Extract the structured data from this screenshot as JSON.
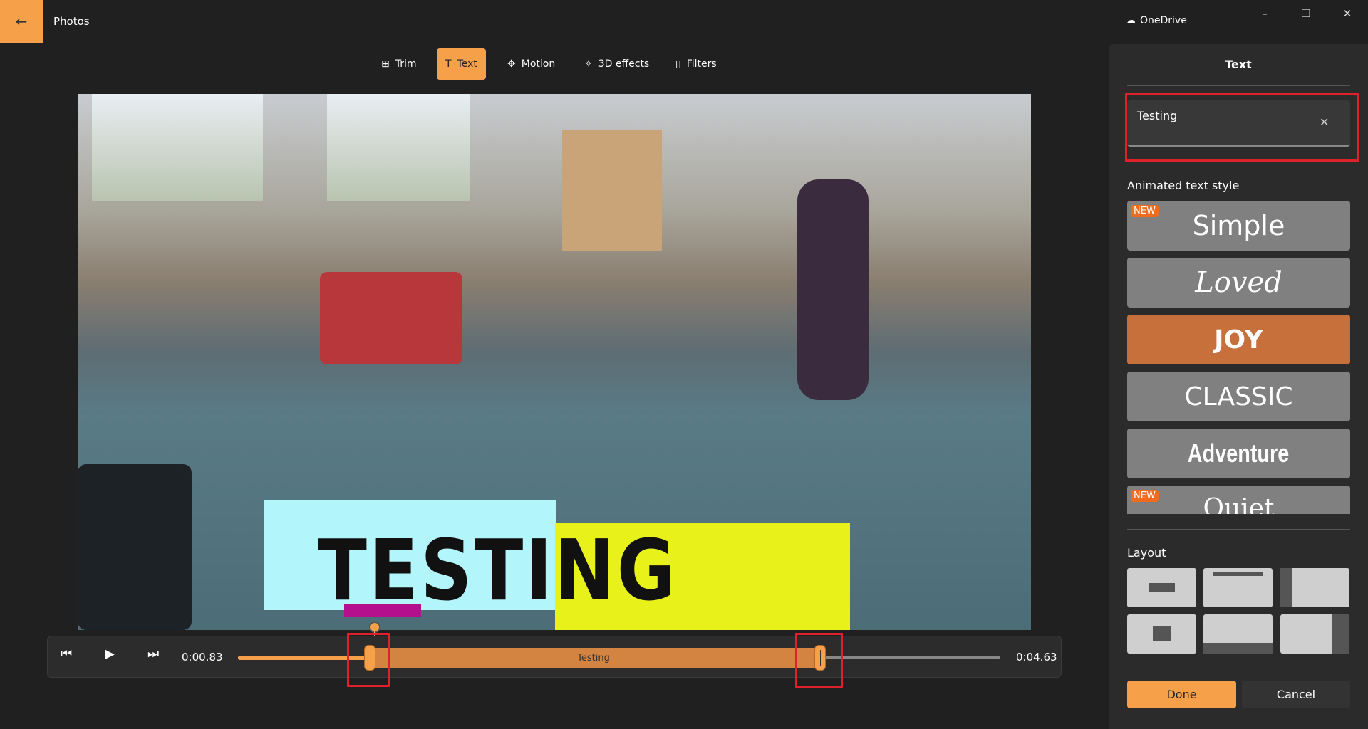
{
  "app": {
    "title": "Photos",
    "account": "OneDrive",
    "back_icon": "arrow-left-icon"
  },
  "window": {
    "minimize": "–",
    "restore": "❐",
    "close": "✕"
  },
  "toolbar": {
    "items": [
      {
        "label": "Trim",
        "icon": "trim-icon",
        "active": false
      },
      {
        "label": "Text",
        "icon": "text-add-icon",
        "active": true
      },
      {
        "label": "Motion",
        "icon": "motion-icon",
        "active": false
      },
      {
        "label": "3D effects",
        "icon": "3d-effects-icon",
        "active": false
      },
      {
        "label": "Filters",
        "icon": "filters-icon",
        "active": false
      }
    ]
  },
  "preview": {
    "overlay_text": "TESTING"
  },
  "timeline": {
    "current_time": "0:00.83",
    "end_time": "0:04.63",
    "clip_label": "Testing"
  },
  "panel": {
    "title": "Text",
    "text_value": "Testing",
    "style_label": "Animated text style",
    "styles": [
      {
        "label": "Simple",
        "badge": "NEW"
      },
      {
        "label": "Loved"
      },
      {
        "label": "JOY",
        "selected": true
      },
      {
        "label": "CLASSIC"
      },
      {
        "label": "Adventure"
      },
      {
        "label": "Quiet",
        "badge": "NEW"
      }
    ],
    "layout_label": "Layout",
    "done": "Done",
    "cancel": "Cancel"
  },
  "colors": {
    "accent": "#f7a04a",
    "selected_style": "#c8703c",
    "highlight": "#e0202a"
  }
}
